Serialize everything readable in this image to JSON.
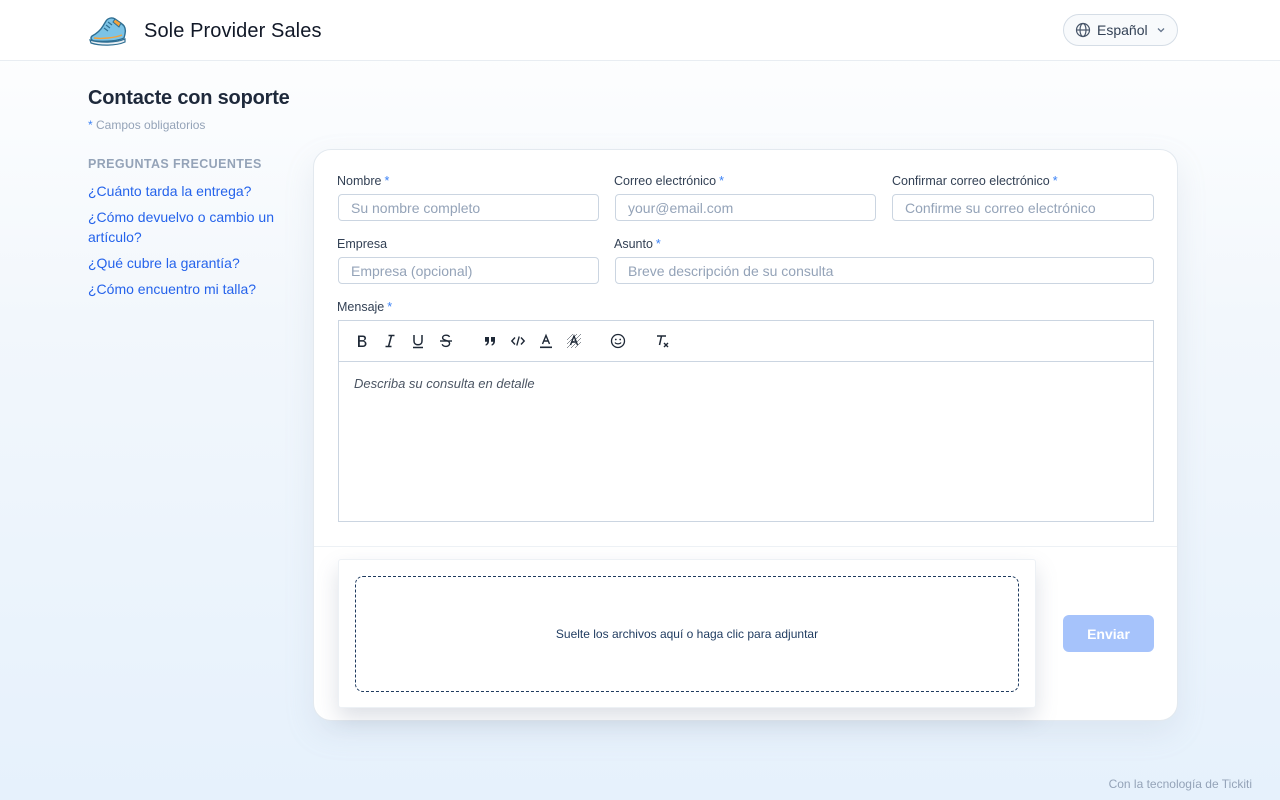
{
  "header": {
    "brand_name": "Sole Provider Sales",
    "logo_icon": "sneaker-icon",
    "language": "Español"
  },
  "page": {
    "title": "Contacte con soporte",
    "required_star": "*",
    "required_note": "Campos obligatorios"
  },
  "faq": {
    "heading": "PREGUNTAS FRECUENTES",
    "items": [
      "¿Cuánto tarda la entrega?",
      "¿Cómo devuelvo o cambio un artículo?",
      "¿Qué cubre la garantía?",
      "¿Cómo encuentro mi talla?"
    ]
  },
  "form": {
    "required_mark": "*",
    "name": {
      "label": "Nombre",
      "placeholder": "Su nombre completo",
      "value": ""
    },
    "email": {
      "label": "Correo electrónico",
      "placeholder": "your@email.com",
      "value": ""
    },
    "confirm_email": {
      "label": "Confirmar correo electrónico",
      "placeholder": "Confirme su correo electrónico",
      "value": ""
    },
    "company": {
      "label": "Empresa",
      "placeholder": "Empresa (opcional)",
      "value": ""
    },
    "subject": {
      "label": "Asunto",
      "placeholder": "Breve descripción de su consulta",
      "value": ""
    },
    "message": {
      "label": "Mensaje",
      "placeholder": "Describa su consulta en detalle",
      "toolbar": [
        "bold-icon",
        "italic-icon",
        "underline-icon",
        "strikethrough-icon",
        "quote-icon",
        "code-icon",
        "text-color-icon",
        "highlight-icon",
        "emoji-icon",
        "clear-format-icon"
      ]
    },
    "dropzone_text": "Suelte los archivos aquí o haga clic para adjuntar",
    "submit_label": "Enviar"
  },
  "footer": {
    "powered_by": "Con la tecnología de Tickiti"
  },
  "colors": {
    "accent": "#3b82f6",
    "link": "#2563eb",
    "submit_disabled": "#a6c3fb"
  }
}
